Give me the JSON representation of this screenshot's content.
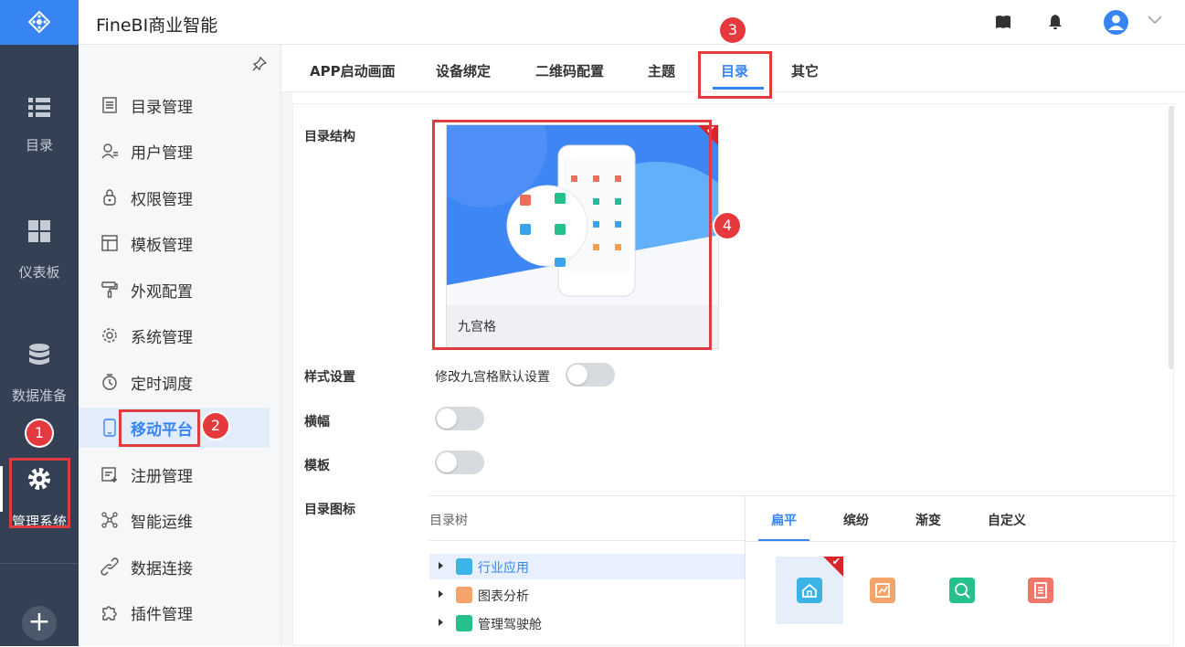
{
  "app": {
    "title": "FineBI商业智能"
  },
  "rail": {
    "items": [
      {
        "label": "目录",
        "icon": "list-icon"
      },
      {
        "label": "仪表板",
        "icon": "dashboard-icon"
      },
      {
        "label": "数据准备",
        "icon": "database-icon"
      },
      {
        "label": "管理系统",
        "icon": "gear-icon"
      }
    ],
    "plus": "+"
  },
  "nav": {
    "items": [
      {
        "label": "目录管理"
      },
      {
        "label": "用户管理"
      },
      {
        "label": "权限管理"
      },
      {
        "label": "模板管理"
      },
      {
        "label": "外观配置"
      },
      {
        "label": "系统管理"
      },
      {
        "label": "定时调度"
      },
      {
        "label": "移动平台"
      },
      {
        "label": "注册管理"
      },
      {
        "label": "智能运维"
      },
      {
        "label": "数据连接"
      },
      {
        "label": "插件管理"
      }
    ],
    "active": "移动平台"
  },
  "tabs": [
    {
      "label": "APP启动画面"
    },
    {
      "label": "设备绑定"
    },
    {
      "label": "二维码配置"
    },
    {
      "label": "主题"
    },
    {
      "label": "目录"
    },
    {
      "label": "其它"
    }
  ],
  "form": {
    "catalog_structure": "目录结构",
    "layout_card_caption": "九宫格",
    "style_settings": "样式设置",
    "style_toggle_label": "修改九宫格默认设置",
    "landscape": "横幅",
    "template": "模板",
    "catalog_icon": "目录图标"
  },
  "tree": {
    "header": "目录树",
    "nodes": [
      {
        "label": "行业应用",
        "color": "#3bb3e4"
      },
      {
        "label": "图表分析",
        "color": "#f4a36a"
      },
      {
        "label": "管理驾驶舱",
        "color": "#25c08b"
      }
    ]
  },
  "icon_styles": {
    "tabs": [
      {
        "label": "扁平"
      },
      {
        "label": "缤纷"
      },
      {
        "label": "渐变"
      },
      {
        "label": "自定义"
      }
    ],
    "swatches": [
      "#3bb3e4",
      "#f4a36a",
      "#25c08b",
      "#f1766a"
    ]
  },
  "callouts": [
    "1",
    "2",
    "3",
    "4"
  ],
  "colors": {
    "accent": "#3685f2",
    "sidebar": "#344154",
    "highlight": "#e03c3f"
  }
}
